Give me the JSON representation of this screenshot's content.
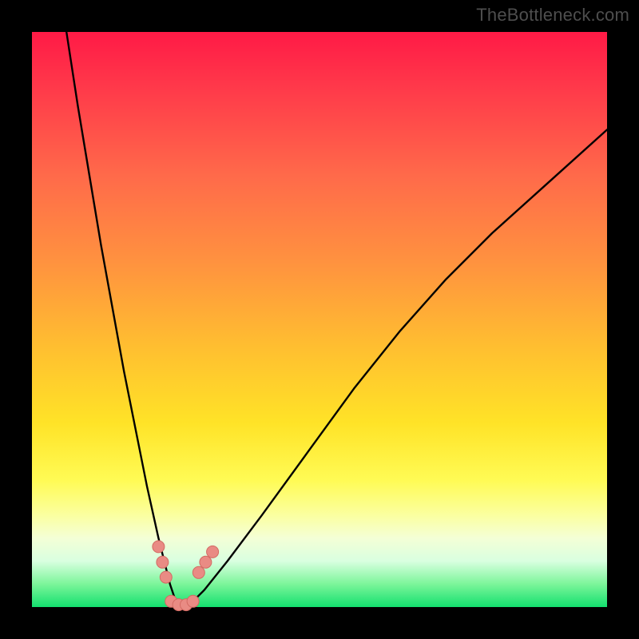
{
  "watermark": "TheBottleneck.com",
  "chart_data": {
    "type": "line",
    "title": "",
    "xlabel": "",
    "ylabel": "",
    "xlim": [
      0,
      100
    ],
    "ylim": [
      0,
      100
    ],
    "series": [
      {
        "name": "bottleneck-curve",
        "x": [
          6,
          8,
          10,
          12,
          14,
          16,
          18,
          20,
          22,
          23,
          24,
          25,
          26,
          27,
          28,
          30,
          34,
          40,
          48,
          56,
          64,
          72,
          80,
          90,
          100
        ],
        "values": [
          100,
          87,
          75,
          63,
          52,
          41,
          31,
          21,
          12,
          8,
          4,
          1,
          0,
          0,
          1,
          3,
          8,
          16,
          27,
          38,
          48,
          57,
          65,
          74,
          83
        ]
      }
    ],
    "markers": [
      {
        "name": "left-cluster",
        "x": [
          22.0,
          22.7,
          23.3
        ],
        "y": [
          10.5,
          7.8,
          5.2
        ]
      },
      {
        "name": "right-cluster",
        "x": [
          29.0,
          30.2,
          31.4
        ],
        "y": [
          6.0,
          7.8,
          9.6
        ]
      },
      {
        "name": "bottom-cluster",
        "x": [
          24.2,
          25.5,
          26.8,
          28.0
        ],
        "y": [
          1.0,
          0.4,
          0.4,
          1.0
        ]
      }
    ],
    "green_band": {
      "y_top": 3.5,
      "y_bottom": 0
    }
  },
  "colors": {
    "curve": "#000000",
    "marker_fill": "#e98b84",
    "marker_stroke": "#d36a63"
  }
}
